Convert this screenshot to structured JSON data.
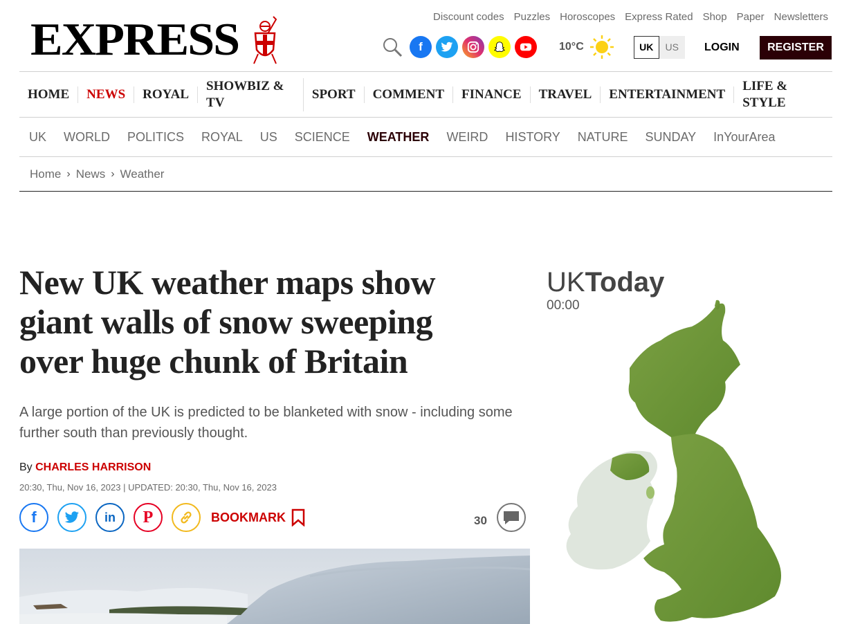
{
  "header": {
    "logo_text": "EXPRESS",
    "top_links": [
      "Discount codes",
      "Puzzles",
      "Horoscopes",
      "Express Rated",
      "Shop",
      "Paper",
      "Newsletters"
    ],
    "social_icons": [
      {
        "name": "facebook-icon",
        "glyph": "f",
        "color": "#1877f2"
      },
      {
        "name": "twitter-icon",
        "glyph": "t",
        "color": "#1da1f2"
      },
      {
        "name": "instagram-icon",
        "glyph": "◎",
        "color": "#c13584"
      },
      {
        "name": "snapchat-icon",
        "glyph": "✿",
        "color": "#fffc00"
      },
      {
        "name": "youtube-icon",
        "glyph": "▶",
        "color": "#ff0000"
      }
    ],
    "temperature": "10°C",
    "weather_icon": "sun-icon",
    "editions": {
      "uk": "UK",
      "us": "US",
      "selected": "UK"
    },
    "login_label": "LOGIN",
    "register_label": "REGISTER",
    "accent_color": "#2b0006"
  },
  "main_nav": {
    "items": [
      "HOME",
      "NEWS",
      "ROYAL",
      "SHOWBIZ & TV",
      "SPORT",
      "COMMENT",
      "FINANCE",
      "TRAVEL",
      "ENTERTAINMENT",
      "LIFE & STYLE"
    ],
    "active": "NEWS"
  },
  "sub_nav": {
    "items": [
      "UK",
      "WORLD",
      "POLITICS",
      "ROYAL",
      "US",
      "SCIENCE",
      "WEATHER",
      "WEIRD",
      "HISTORY",
      "NATURE",
      "SUNDAY",
      "InYourArea"
    ],
    "active": "WEATHER"
  },
  "breadcrumb": [
    "Home",
    "News",
    "Weather"
  ],
  "article": {
    "headline": "New UK weather maps show giant walls of snow sweeping over huge chunk of Britain",
    "standfirst": "A large portion of the UK is predicted to be blanketed with snow - including some further south than previously thought.",
    "by_prefix": "By",
    "author": "CHARLES HARRISON",
    "dates": "20:30, Thu, Nov 16, 2023 | UPDATED: 20:30, Thu, Nov 16, 2023",
    "bookmark_label": "BOOKMARK",
    "comment_count": "30"
  },
  "weather_widget": {
    "title_prefix": "UK",
    "title_main": "Today",
    "time": "00:00"
  }
}
